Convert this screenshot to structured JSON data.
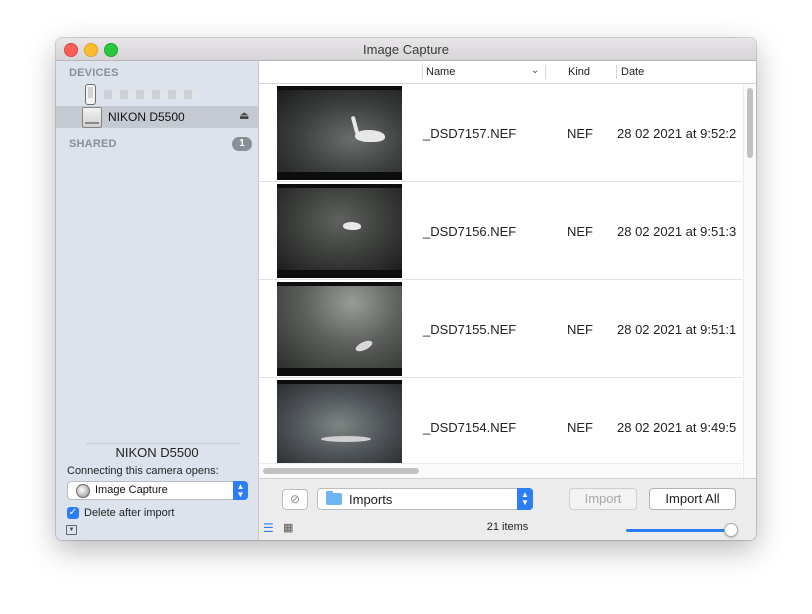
{
  "window": {
    "title": "Image Capture"
  },
  "sidebar": {
    "devices_header": "DEVICES",
    "camera_label": "NIKON D5500",
    "shared_header": "SHARED",
    "shared_count": "1",
    "device_name": "NIKON D5500",
    "opens_label": "Connecting this camera opens:",
    "opens_app": "Image Capture",
    "delete_after_import_label": "Delete after import",
    "delete_after_import_checked": true
  },
  "columns": {
    "name": "Name",
    "kind": "Kind",
    "date": "Date"
  },
  "files": [
    {
      "name": "_DSD7157.NEF",
      "kind": "NEF",
      "date": "28 02 2021 at 9:52:2"
    },
    {
      "name": "_DSD7156.NEF",
      "kind": "NEF",
      "date": "28 02 2021 at 9:51:3"
    },
    {
      "name": "_DSD7155.NEF",
      "kind": "NEF",
      "date": "28 02 2021 at 9:51:1"
    },
    {
      "name": "_DSD7154.NEF",
      "kind": "NEF",
      "date": "28 02 2021 at 9:49:5"
    }
  ],
  "bottom": {
    "destination": "Imports",
    "import_label": "Import",
    "import_all_label": "Import All",
    "item_count": "21 items"
  },
  "colors": {
    "accent": "#2d7df6",
    "sidebar_bg": "#dde3ec",
    "selection": "#c5cad2"
  }
}
